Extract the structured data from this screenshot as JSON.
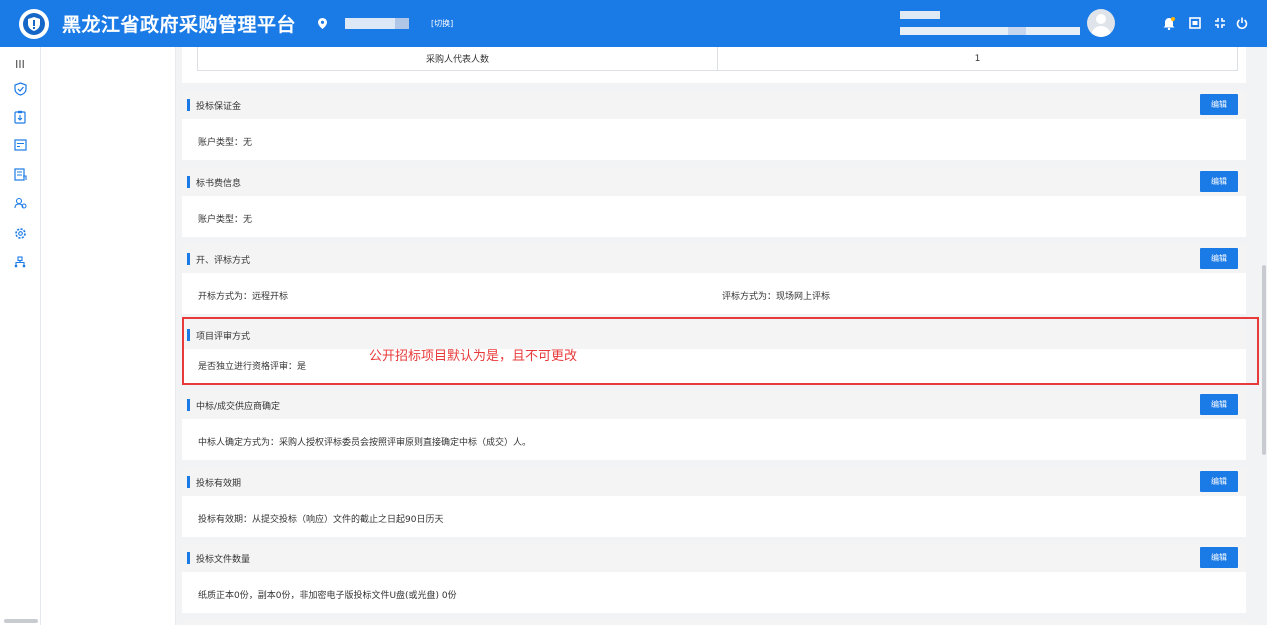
{
  "header": {
    "title": "黑龙江省政府采购管理平台",
    "switch_label": "[切换]",
    "icons": [
      "location-icon",
      "bell-icon",
      "window-icon",
      "fullscreen-icon",
      "power-icon"
    ],
    "accent": "#1a7ae6"
  },
  "sidebar": {
    "icons": [
      "menu-icon",
      "shield-icon",
      "clipboard-icon",
      "list-icon",
      "document-icon",
      "users-icon",
      "gear-icon",
      "org-icon"
    ]
  },
  "top_table": {
    "label": "采购人代表人数",
    "value": "1"
  },
  "sections": [
    {
      "title": "投标保证金",
      "edit": "编辑",
      "content": "账户类型：无"
    },
    {
      "title": "标书费信息",
      "edit": "编辑",
      "content": "账户类型：无"
    },
    {
      "title": "开、评标方式",
      "edit": "编辑",
      "content_left": "开标方式为：远程开标",
      "content_right": "评标方式为：现场网上评标"
    },
    {
      "title": "项目评审方式",
      "content": "是否独立进行资格评审：是"
    },
    {
      "title": "中标/成交供应商确定",
      "edit": "编辑",
      "content": "中标人确定方式为：采购人授权评标委员会按照评审原则直接确定中标（成交）人。"
    },
    {
      "title": "投标有效期",
      "edit": "编辑",
      "content": "投标有效期：从提交投标（响应）文件的截止之日起90日历天"
    },
    {
      "title": "投标文件数量",
      "edit": "编辑",
      "content": "纸质正本0份，副本0份，非加密电子版投标文件U盘(或光盘) 0份"
    }
  ],
  "annotation": {
    "text": "公开招标项目默认为是，且不可更改",
    "color": "#e83a3a"
  }
}
